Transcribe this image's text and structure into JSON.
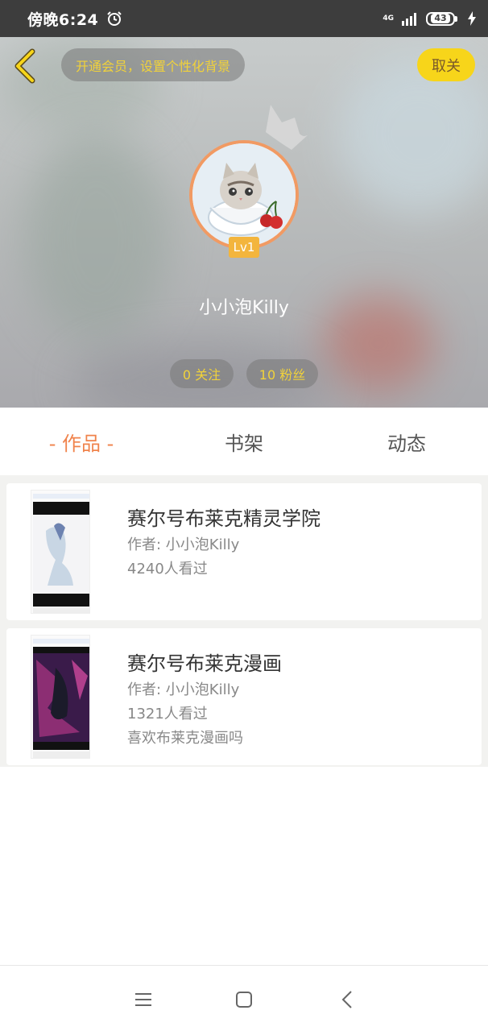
{
  "status_bar": {
    "time": "傍晚6:24",
    "network": "4G",
    "battery": "43",
    "icons": [
      "alarm-icon",
      "signal-icon",
      "battery-icon",
      "charging-bolt-icon"
    ]
  },
  "header": {
    "back_icon": "chevron-left-icon",
    "member_banner": "开通会员，设置个性化背景",
    "unfollow_label": "取关",
    "crown_icon": "crown-icon",
    "level": "Lv1",
    "username": "小小泡Killy",
    "follow_stat": "0 关注",
    "fans_stat": "10 粉丝",
    "accent": "#f7d51a",
    "gold_text": "#f1d23a"
  },
  "tabs": [
    {
      "label": "- 作品 -",
      "active": true
    },
    {
      "label": "书架",
      "active": false
    },
    {
      "label": "动态",
      "active": false
    }
  ],
  "works": [
    {
      "title": "赛尔号布莱克精灵学院",
      "author": "作者: 小小泡Killy",
      "views": "4240人看过",
      "description": ""
    },
    {
      "title": "赛尔号布莱克漫画",
      "author": "作者: 小小泡Killy",
      "views": "1321人看过",
      "description": "喜欢布莱克漫画吗"
    }
  ],
  "bottom_nav": {
    "icons": [
      "menu-icon",
      "home-square-icon",
      "back-triangle-icon"
    ]
  },
  "colors": {
    "tab_active": "#f0834c",
    "avatar_border": "#f19a63",
    "level_badge": "#f3b53d"
  }
}
